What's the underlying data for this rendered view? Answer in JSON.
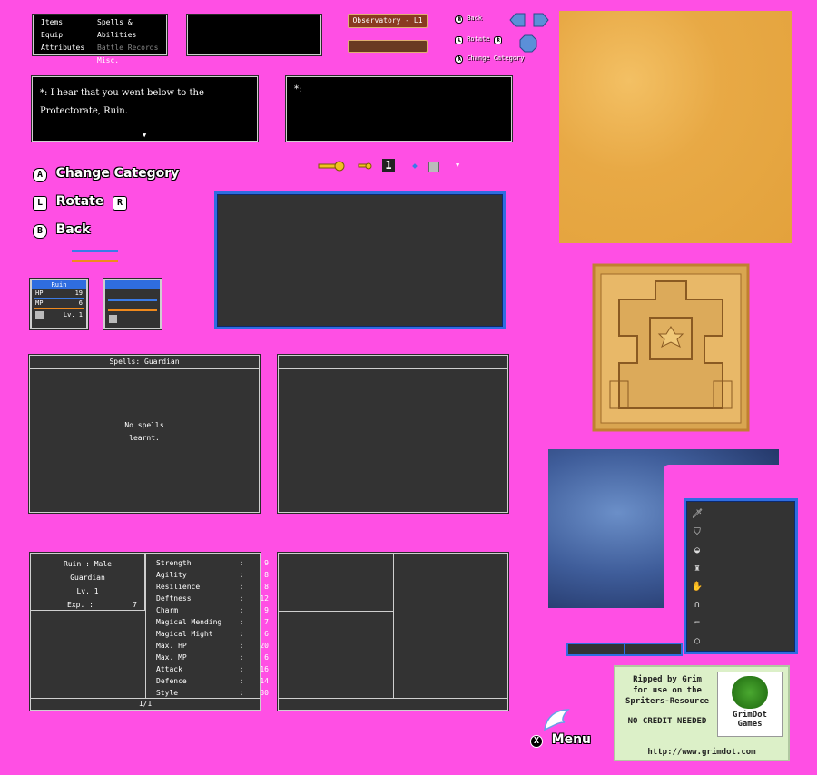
{
  "main_menu": {
    "col1": [
      "Items",
      "Equip",
      "Attributes"
    ],
    "col2": [
      "Spells & Abilities",
      "Battle Records",
      "Misc."
    ]
  },
  "location": {
    "label": "Observatory - L1"
  },
  "small_hints": {
    "back": "Back",
    "rotate": "Rotate",
    "change": "Change Category",
    "btn_b": "B",
    "btn_l": "L",
    "btn_r": "R",
    "btn_a": "A"
  },
  "dialog": {
    "speaker": "*:",
    "line1": "I hear that you went below to the",
    "line2": "Protectorate, Ruin.",
    "speaker2": "*:"
  },
  "controls": {
    "change_category": "Change Category",
    "rotate": "Rotate",
    "back": "Back",
    "btn_a": "A",
    "btn_l": "L",
    "btn_r": "R",
    "btn_b": "B"
  },
  "toolbar": {
    "quantity": "1"
  },
  "party": {
    "name": "Ruin",
    "hp_label": "HP",
    "hp": "19",
    "mp_label": "MP",
    "mp": "6",
    "lv_label": "Lv.",
    "lv": "1"
  },
  "spells_panel": {
    "title": "Spells: Guardian",
    "empty_line1": "No spells",
    "empty_line2": "learnt."
  },
  "attributes": {
    "name_line": "Ruin  :  Male",
    "class": "Guardian",
    "level": "Lv. 1",
    "exp_label": "Exp. :",
    "exp_value": "7",
    "page": "1/1",
    "stats": [
      {
        "name": "Strength",
        "value": "9"
      },
      {
        "name": "Agility",
        "value": "8"
      },
      {
        "name": "Resilience",
        "value": "8"
      },
      {
        "name": "Deftness",
        "value": "12"
      },
      {
        "name": "Charm",
        "value": "9"
      },
      {
        "name": "Magical Mending",
        "value": "7"
      },
      {
        "name": "Magical Might",
        "value": "6"
      },
      {
        "name": "Max. HP",
        "value": "20"
      },
      {
        "name": "Max. MP",
        "value": "6"
      },
      {
        "name": "Attack",
        "value": "16"
      },
      {
        "name": "Defence",
        "value": "14"
      },
      {
        "name": "Style",
        "value": "30"
      }
    ]
  },
  "equip_icons": [
    "sword-icon",
    "shield-icon",
    "helmet-icon",
    "armor-icon",
    "gauntlet-icon",
    "leggings-icon",
    "boots-icon",
    "ring-icon"
  ],
  "credits": {
    "line1": "Ripped by Grim",
    "line2": "for use on the",
    "line3": "Spriters-Resource",
    "line4": "NO CREDIT NEEDED",
    "logo1": "GrimDot",
    "logo2": "Games",
    "url": "http://www.grimdot.com"
  },
  "menu_button": {
    "label": "Menu",
    "btn": "X"
  },
  "colors": {
    "background": "#ff4fe4",
    "panel": "#333333",
    "hp_bar": "#3a7be8",
    "mp_bar": "#f08a1c",
    "frame_blue": "#2f6de0"
  }
}
